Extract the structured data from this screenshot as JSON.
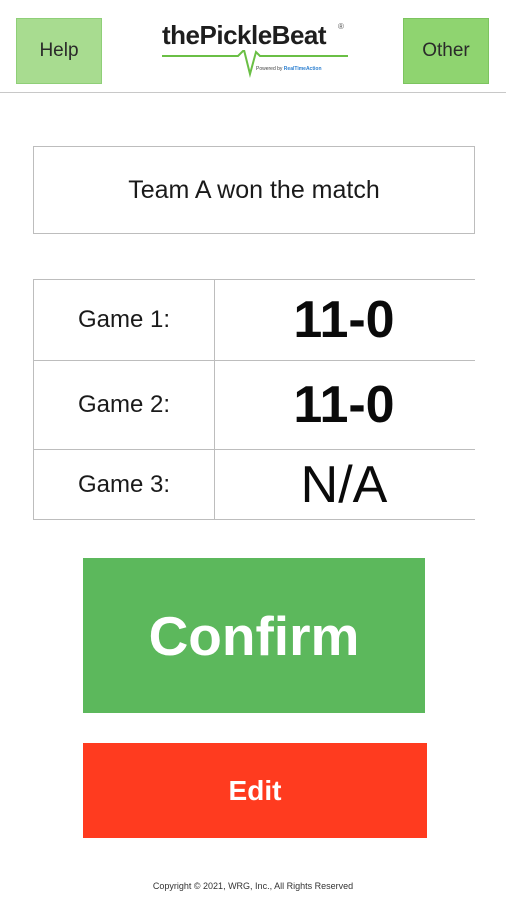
{
  "header": {
    "help_label": "Help",
    "other_label": "Other",
    "logo_text": "thePickleBeat",
    "logo_powered_by": "Powered by",
    "logo_brand": "RealTimeAction"
  },
  "result": {
    "message": "Team A won the match"
  },
  "games": [
    {
      "label": "Game 1:",
      "score": "11-0"
    },
    {
      "label": "Game 2:",
      "score": "11-0"
    },
    {
      "label": "Game 3:",
      "score": "N/A"
    }
  ],
  "actions": {
    "confirm_label": "Confirm",
    "edit_label": "Edit"
  },
  "footer": {
    "copyright": "Copyright © 2021, WRG, Inc., All Rights Reserved"
  },
  "colors": {
    "header_button": "#a8dc90",
    "confirm": "#5cb85c",
    "edit": "#ff3b1f",
    "logo_pulse": "#6abf45"
  }
}
